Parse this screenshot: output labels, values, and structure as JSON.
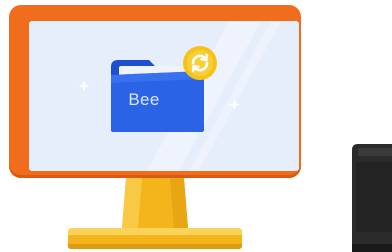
{
  "folder": {
    "label": "Bee"
  },
  "icons": {
    "folder": "folder-icon",
    "sync": "sync-icon",
    "sparkle": "sparkle-icon",
    "computer_tower": "computer-tower-icon"
  },
  "colors": {
    "monitor_frame": "#f06d1e",
    "screen": "#e6edfb",
    "folder_blue": "#2a63e6",
    "badge_yellow": "#f6c21a",
    "stand_yellow": "#f4b51c",
    "tower": "#2b2b2b"
  }
}
